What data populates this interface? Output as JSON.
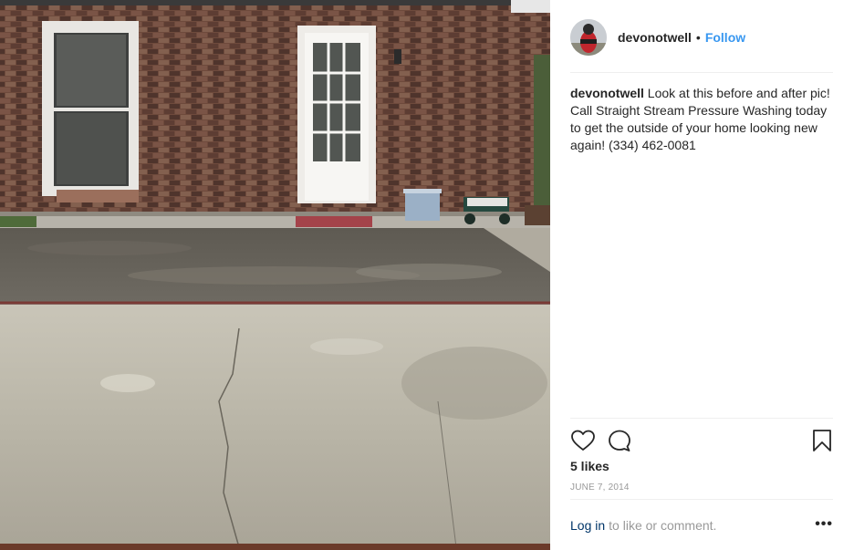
{
  "post": {
    "username": "devonotwell",
    "separator": "•",
    "follow_label": "Follow",
    "caption_user": "devonotwell",
    "caption_text": "Look at this before and after pic! Call Straight Stream Pressure Washing today to get the outside of your home looking new again! (334) 462-0081",
    "likes": "5 likes",
    "date": "JUNE 7, 2014",
    "login_link": "Log in",
    "login_tail": "to like or comment.",
    "more_label": "•••"
  },
  "icons": {
    "like": "heart-icon",
    "comment": "speech-bubble-icon",
    "save": "bookmark-icon",
    "more": "more-options-icon"
  },
  "colors": {
    "follow_blue": "#3897f0",
    "login_blue": "#003569",
    "muted_gray": "#999999",
    "divider": "#efefef"
  }
}
